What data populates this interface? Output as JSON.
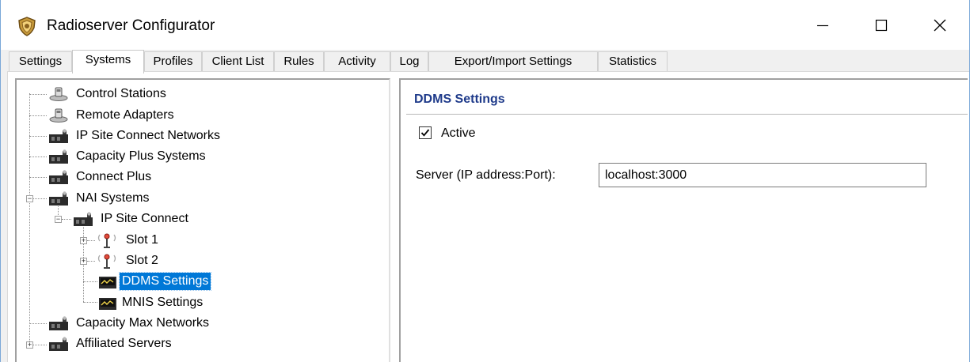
{
  "window": {
    "title": "Radioserver Configurator",
    "controls": {
      "minimize": "minimize",
      "maximize": "maximize",
      "close": "close"
    }
  },
  "tabs": [
    {
      "label": "Settings",
      "active": false
    },
    {
      "label": "Systems",
      "active": true
    },
    {
      "label": "Profiles",
      "active": false
    },
    {
      "label": "Client List",
      "active": false
    },
    {
      "label": "Rules",
      "active": false
    },
    {
      "label": "Activity",
      "active": false
    },
    {
      "label": "Log",
      "active": false
    },
    {
      "label": "Export/Import Settings",
      "active": false
    },
    {
      "label": "Statistics",
      "active": false
    }
  ],
  "tree": {
    "nodes": [
      {
        "label": "Control Stations",
        "icon": "control-station-icon"
      },
      {
        "label": "Remote Adapters",
        "icon": "control-station-icon"
      },
      {
        "label": "IP Site Connect Networks",
        "icon": "radio-system-icon"
      },
      {
        "label": "Capacity Plus Systems",
        "icon": "radio-system-icon"
      },
      {
        "label": "Connect Plus",
        "icon": "radio-system-icon"
      },
      {
        "label": "NAI Systems",
        "icon": "radio-system-icon",
        "expanded": true
      },
      {
        "label": "IP Site Connect",
        "icon": "radio-system-icon",
        "expanded": true
      },
      {
        "label": "Slot 1",
        "icon": "antenna-icon",
        "expanded": false
      },
      {
        "label": "Slot 2",
        "icon": "antenna-icon",
        "expanded": false
      },
      {
        "label": "DDMS Settings",
        "icon": "settings-monitor-icon",
        "selected": true
      },
      {
        "label": "MNIS Settings",
        "icon": "settings-monitor-icon"
      },
      {
        "label": "Capacity Max Networks",
        "icon": "radio-system-icon"
      },
      {
        "label": "Affiliated Servers",
        "icon": "radio-system-icon",
        "expanded": false
      }
    ]
  },
  "detail": {
    "section_title": "DDMS Settings",
    "active_label": "Active",
    "active_checked": true,
    "server_label": "Server (IP address:Port):",
    "server_value": "localhost:3000"
  },
  "colors": {
    "selection": "#0078d7",
    "section_title": "#1e3a8a"
  }
}
